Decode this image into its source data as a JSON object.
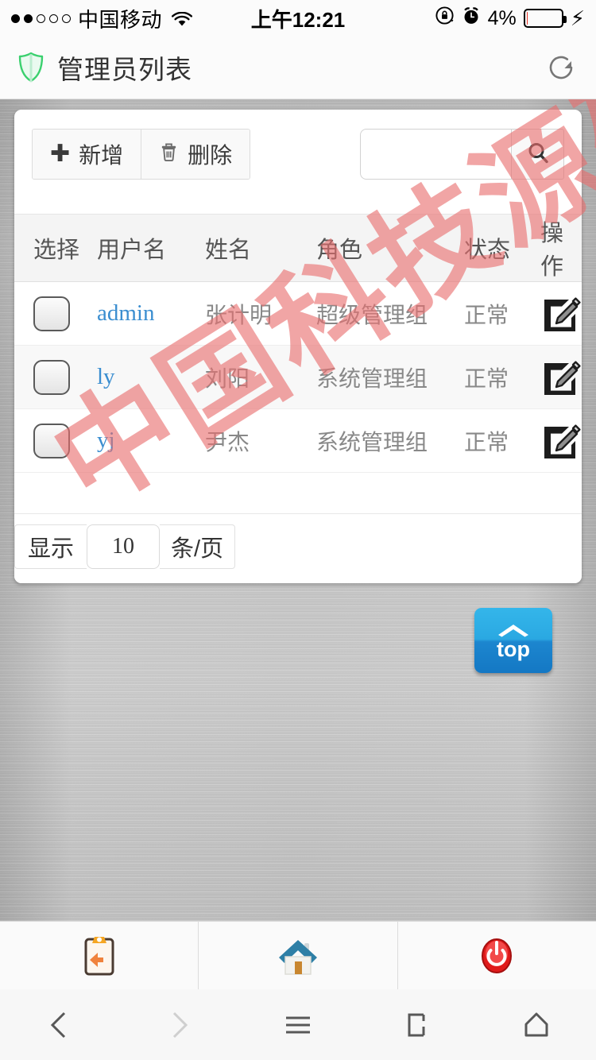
{
  "statusbar": {
    "signal_dots_filled": 2,
    "signal_dots_total": 5,
    "carrier": "中国移动",
    "wifi_icon": "wifi-icon",
    "time": "上午12:21",
    "lock_icon": "rotation-lock-icon",
    "alarm_icon": "alarm-clock-icon",
    "battery_percent": "4%",
    "battery_level": 4,
    "charging_icon": "lightning-bolt-icon"
  },
  "header": {
    "shield_icon": "shield-icon",
    "title": "管理员列表",
    "refresh_icon": "refresh-icon",
    "shield_color": "#3ad06e"
  },
  "toolbar": {
    "add_label": "新增",
    "add_icon": "plus-icon",
    "delete_label": "删除",
    "delete_icon": "trash-icon",
    "search_value": "",
    "search_placeholder": "",
    "search_icon": "search-icon"
  },
  "table": {
    "columns": [
      "选择",
      "用户名",
      "姓名",
      "角色",
      "状态",
      "操作"
    ],
    "rows": [
      {
        "checkbox_icon": "checkbox-unchecked",
        "username": "admin",
        "name": "张计明",
        "role": "超级管理组",
        "status": "正常",
        "edit_icon": "edit-pencil-icon"
      },
      {
        "checkbox_icon": "checkbox-unchecked",
        "username": "ly",
        "name": "刘阳",
        "role": "系统管理组",
        "status": "正常",
        "edit_icon": "edit-pencil-icon"
      },
      {
        "checkbox_icon": "checkbox-unchecked",
        "username": "yj",
        "name": "尹杰",
        "role": "系统管理组",
        "status": "正常",
        "edit_icon": "edit-pencil-icon"
      }
    ],
    "link_color": "#3b8ed0"
  },
  "pager": {
    "prefix": "显示",
    "per_page": "10",
    "suffix": "条/页"
  },
  "watermark": {
    "text": "中国科技源码",
    "color": "#e86e6e"
  },
  "top_button": {
    "label": "top",
    "icon": "chevron-up-icon",
    "color": "#2aa8e2"
  },
  "bottom_bar": {
    "items": [
      {
        "icon": "clipboard-back-icon",
        "name": "return"
      },
      {
        "icon": "home-house-icon",
        "name": "home"
      },
      {
        "icon": "power-off-icon",
        "name": "logout"
      }
    ]
  },
  "navbar": {
    "items": [
      {
        "icon": "chevron-left-icon",
        "name": "back"
      },
      {
        "icon": "chevron-right-icon",
        "name": "forward"
      },
      {
        "icon": "hamburger-menu-icon",
        "name": "menu"
      },
      {
        "icon": "tabs-page-icon",
        "name": "tabs"
      },
      {
        "icon": "home-outline-icon",
        "name": "browser-home"
      }
    ]
  }
}
